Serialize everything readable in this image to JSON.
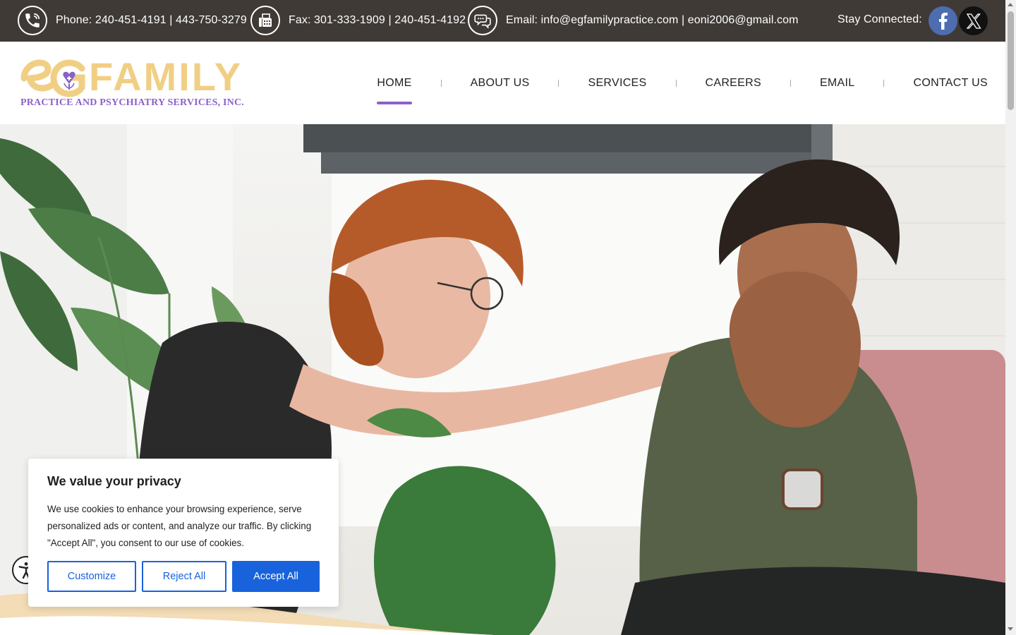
{
  "topbar": {
    "phone": "Phone: 240-451-4191 | 443-750-3279",
    "fax": "Fax: 301-333-1909 | 240-451-4192",
    "email": "Email: info@egfamilypractice.com | eoni2006@gmail.com",
    "stay_connected": "Stay Connected:",
    "background_color": "#3f3a36",
    "icons": [
      "phone-icon",
      "fax-icon",
      "chat-icon",
      "facebook-icon",
      "x-icon"
    ]
  },
  "logo": {
    "mark": "eG",
    "name": "FAMILY",
    "tagline": "PRACTICE AND PSYCHIATRY SERVICES, INC.",
    "gold_color": "#f0cf85",
    "purple_color": "#8a62c9"
  },
  "nav": {
    "items": [
      {
        "label": "HOME",
        "active": true
      },
      {
        "label": "ABOUT US",
        "active": false
      },
      {
        "label": "SERVICES",
        "active": false
      },
      {
        "label": "CAREERS",
        "active": false
      },
      {
        "label": "EMAIL",
        "active": false
      },
      {
        "label": "CONTACT US",
        "active": false
      }
    ],
    "active_indicator_color": "#8a62c9"
  },
  "hero": {
    "image": "therapist-comforting-client-photo"
  },
  "cookie_banner": {
    "title": "We value your privacy",
    "body": "We use cookies to enhance your browsing experience, serve personalized ads or content, and analyze our traffic. By clicking \"Accept All\", you consent to our use of cookies.",
    "buttons": {
      "customize": "Customize",
      "reject": "Reject All",
      "accept": "Accept All"
    },
    "accent_color": "#1863dc"
  },
  "accessibility_button": {
    "icon": "accessibility-icon"
  }
}
